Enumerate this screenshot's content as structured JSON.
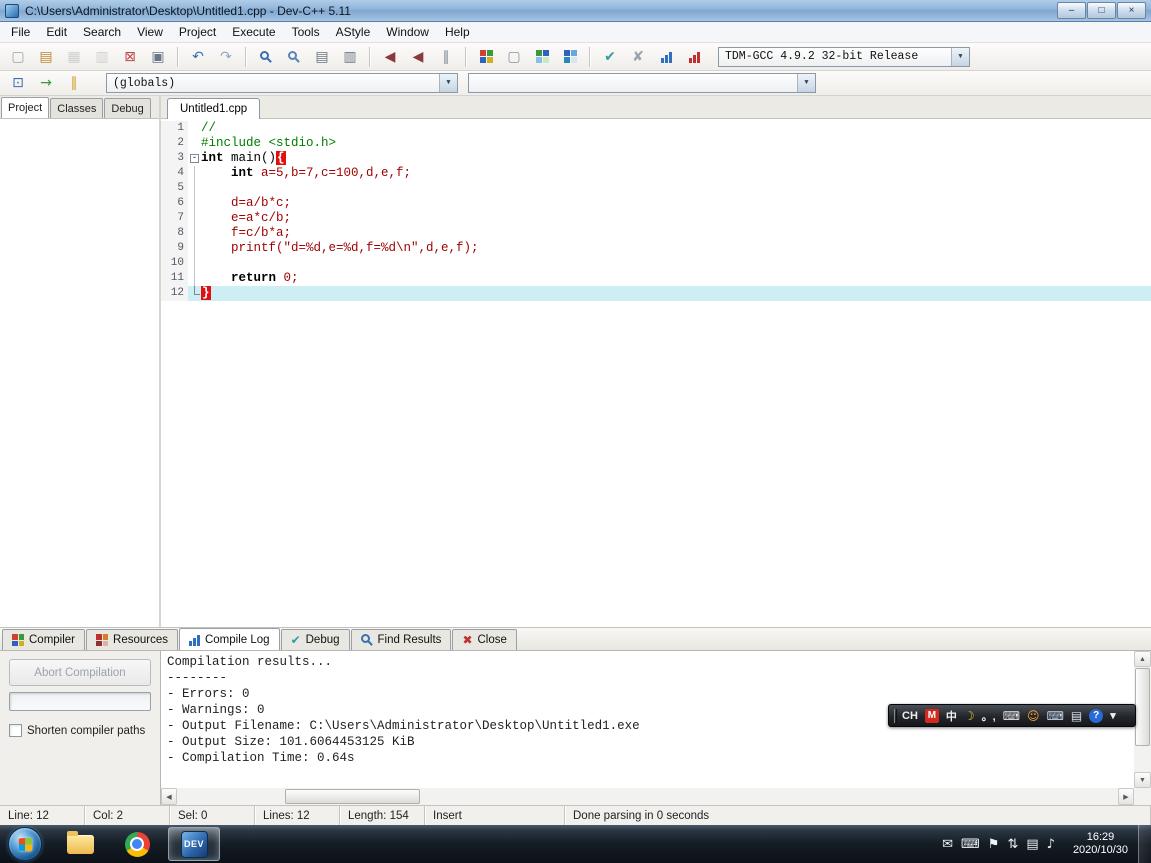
{
  "window": {
    "title": "C:\\Users\\Administrator\\Desktop\\Untitled1.cpp - Dev-C++ 5.11",
    "minimize_glyph": "–",
    "maximize_glyph": "□",
    "close_glyph": "×"
  },
  "ui": {
    "dropdown_arrow": "▼",
    "scroll_up": "▲",
    "scroll_down": "▼",
    "scroll_left": "◀",
    "scroll_right": "▶"
  },
  "colors": {
    "preprocessor_green": "#007d00",
    "code_red": "#9e0000",
    "brace_highlight": "#e01010",
    "current_line": "#cdeef2",
    "accent_blue": "#2f6fbf"
  },
  "menu": [
    "File",
    "Edit",
    "Search",
    "View",
    "Project",
    "Execute",
    "Tools",
    "AStyle",
    "Window",
    "Help"
  ],
  "toolbar1": {
    "compiler_dropdown": "TDM-GCC 4.9.2 32-bit Release",
    "groups": [
      [
        {
          "name": "new-file",
          "kind": "glyph",
          "glyph": "▢",
          "color": "#9aa3ad"
        },
        {
          "name": "open-file",
          "kind": "glyph",
          "glyph": "▤",
          "color": "#c08a30"
        },
        {
          "name": "save",
          "kind": "glyph",
          "glyph": "▦",
          "color": "#8a93a0",
          "disabled": true
        },
        {
          "name": "save-all",
          "kind": "glyph",
          "glyph": "▥",
          "color": "#8a93a0",
          "disabled": true
        },
        {
          "name": "close-file",
          "kind": "glyph",
          "glyph": "⊠",
          "color": "#c04848"
        },
        {
          "name": "print",
          "kind": "glyph",
          "glyph": "▣",
          "color": "#6a7687"
        }
      ],
      [
        {
          "name": "undo",
          "kind": "glyph",
          "glyph": "↶",
          "color": "#3d6eb4"
        },
        {
          "name": "redo",
          "kind": "glyph",
          "glyph": "↷",
          "color": "#93a7c0"
        }
      ],
      [
        {
          "name": "find",
          "kind": "mag",
          "color": "#3d6eb4"
        },
        {
          "name": "replace",
          "kind": "mag",
          "color": "#5a82b8"
        },
        {
          "name": "find-next",
          "kind": "glyph",
          "glyph": "▤",
          "color": "#6a7687"
        },
        {
          "name": "goto-line",
          "kind": "glyph",
          "glyph": "▥",
          "color": "#6a7687"
        }
      ],
      [
        {
          "name": "back",
          "kind": "glyph",
          "glyph": "◀",
          "color": "#8a3a3a"
        },
        {
          "name": "forward",
          "kind": "glyph",
          "glyph": "◀",
          "color": "#8a3a3a"
        },
        {
          "name": "pause",
          "kind": "glyph",
          "glyph": "∥",
          "color": "#7a8694"
        }
      ],
      [
        {
          "name": "compile",
          "kind": "grid4",
          "colors": [
            "#d04030",
            "#3a9a3a",
            "#3060c0",
            "#d0b020"
          ]
        },
        {
          "name": "run",
          "kind": "glyph",
          "glyph": "▢",
          "color": "#8a93a0"
        },
        {
          "name": "compile-run",
          "kind": "grid4",
          "colors": [
            "#3a9a3a",
            "#3060c0",
            "#8ac0e8",
            "#c8e8c8"
          ]
        },
        {
          "name": "rebuild-all",
          "kind": "grid4",
          "colors": [
            "#3060c0",
            "#68a8e0",
            "#2888b8",
            "#d8e4f0"
          ]
        }
      ],
      [
        {
          "name": "syntax-check",
          "kind": "glyph",
          "glyph": "✔",
          "color": "#2f9e9e"
        },
        {
          "name": "clean",
          "kind": "glyph",
          "glyph": "✘",
          "color": "#9aa3ad"
        },
        {
          "name": "profile-analysis",
          "kind": "bars",
          "color": "#2f6fbf"
        },
        {
          "name": "delete-profiling",
          "kind": "bars",
          "color": "#c03030"
        }
      ]
    ]
  },
  "toolbar2": {
    "globals_dropdown": "(globals)",
    "members_dropdown": "",
    "buttons": [
      {
        "name": "open-project",
        "kind": "glyph",
        "glyph": "⊡",
        "color": "#3d6eb4"
      },
      {
        "name": "add-to-project",
        "kind": "glyph",
        "glyph": "→",
        "color": "#3a9a3a"
      },
      {
        "name": "pause-execution",
        "kind": "glyph",
        "glyph": "∥",
        "color": "#d0a020"
      }
    ]
  },
  "left_panel": {
    "tabs": [
      {
        "label": "Project",
        "active": true
      },
      {
        "label": "Classes"
      },
      {
        "label": "Debug"
      }
    ]
  },
  "editor": {
    "tab": "Untitled1.cpp",
    "current_line": 12,
    "lines": [
      {
        "n": 1,
        "segs": [
          {
            "t": "//",
            "c": "green"
          }
        ]
      },
      {
        "n": 2,
        "segs": [
          {
            "t": "#include <stdio.h>",
            "c": "green"
          }
        ]
      },
      {
        "n": 3,
        "fold": "start",
        "segs": [
          {
            "t": "int",
            "c": "kw"
          },
          {
            "t": " main()",
            "c": "plain"
          },
          {
            "t": "{",
            "c": "brace"
          }
        ]
      },
      {
        "n": 4,
        "fold": "mid",
        "segs": [
          {
            "t": "    ",
            "c": "plain"
          },
          {
            "t": "int",
            "c": "kw"
          },
          {
            "t": " a=5,b=7,c=100,d,e,f;",
            "c": "red"
          }
        ]
      },
      {
        "n": 5,
        "fold": "mid",
        "segs": []
      },
      {
        "n": 6,
        "fold": "mid",
        "segs": [
          {
            "t": "    ",
            "c": "plain"
          },
          {
            "t": "d=a/b*c;",
            "c": "red"
          }
        ]
      },
      {
        "n": 7,
        "fold": "mid",
        "segs": [
          {
            "t": "    ",
            "c": "plain"
          },
          {
            "t": "e=a*c/b;",
            "c": "red"
          }
        ]
      },
      {
        "n": 8,
        "fold": "mid",
        "segs": [
          {
            "t": "    ",
            "c": "plain"
          },
          {
            "t": "f=c/b*a;",
            "c": "red"
          }
        ]
      },
      {
        "n": 9,
        "fold": "mid",
        "segs": [
          {
            "t": "    ",
            "c": "plain"
          },
          {
            "t": "printf(\"d=%d,e=%d,f=%d\\n\",d,e,f);",
            "c": "red"
          }
        ]
      },
      {
        "n": 10,
        "fold": "mid",
        "segs": []
      },
      {
        "n": 11,
        "fold": "mid",
        "segs": [
          {
            "t": "    ",
            "c": "plain"
          },
          {
            "t": "return",
            "c": "kw"
          },
          {
            "t": " ",
            "c": "plain"
          },
          {
            "t": "0;",
            "c": "red"
          }
        ]
      },
      {
        "n": 12,
        "fold": "end",
        "segs": [
          {
            "t": "}",
            "c": "brace"
          }
        ]
      }
    ]
  },
  "bottom_tabs": [
    {
      "label": "Compiler",
      "icon": {
        "name": "compiler-tab",
        "kind": "grid4",
        "colors": [
          "#d04030",
          "#3a9a3a",
          "#3060c0",
          "#d0b020"
        ]
      }
    },
    {
      "label": "Resources",
      "icon": {
        "name": "resources-tab",
        "kind": "grid4",
        "colors": [
          "#c03030",
          "#d08030",
          "#903030",
          "#e0b0a0"
        ]
      }
    },
    {
      "label": "Compile Log",
      "active": true,
      "icon": {
        "name": "compile-log-tab",
        "kind": "bars",
        "color": "#2f6fbf"
      }
    },
    {
      "label": "Debug",
      "icon": {
        "name": "debug-tab",
        "kind": "glyph",
        "glyph": "✔",
        "color": "#2f9e9e"
      }
    },
    {
      "label": "Find Results",
      "icon": {
        "name": "find-results-tab",
        "kind": "mag",
        "color": "#3d6eb4"
      }
    },
    {
      "label": "Close",
      "icon": {
        "name": "close-tab",
        "kind": "glyph",
        "glyph": "✖",
        "color": "#c03030"
      }
    }
  ],
  "compile_panel": {
    "abort_button": "Abort Compilation",
    "shorten_checkbox": "Shorten compiler paths",
    "log": [
      "Compilation results...",
      "--------",
      "- Errors: 0",
      "- Warnings: 0",
      "- Output Filename: C:\\Users\\Administrator\\Desktop\\Untitled1.exe",
      "- Output Size: 101.6064453125 KiB",
      "- Compilation Time: 0.64s"
    ]
  },
  "status_bar": [
    "Line: 12",
    "Col: 2",
    "Sel: 0",
    "Lines: 12",
    "Length: 154",
    "Insert",
    "Done parsing in 0 seconds"
  ],
  "language_bar": {
    "items": [
      {
        "name": "input-language",
        "kind": "text",
        "text": "CH"
      },
      {
        "name": "ime-brand",
        "kind": "badge",
        "text": "M",
        "bg": "#d42a1e"
      },
      {
        "name": "chinese-mode",
        "kind": "text",
        "text": "中"
      },
      {
        "name": "full-half-moon",
        "kind": "glyph",
        "glyph": "☽",
        "color": "#f4c430"
      },
      {
        "name": "punctuation",
        "kind": "text",
        "text": "。,"
      },
      {
        "name": "soft-keyboard",
        "kind": "glyph",
        "glyph": "⌨",
        "color": "#e8e8e8"
      },
      {
        "name": "emoticon",
        "kind": "glyph",
        "glyph": "☺",
        "color": "#f4a430"
      },
      {
        "name": "keyboard-layout",
        "kind": "glyph",
        "glyph": "⌨",
        "color": "#c8d8e8"
      },
      {
        "name": "word-pad",
        "kind": "glyph",
        "glyph": "▤",
        "color": "#d8e4f0"
      },
      {
        "name": "help",
        "kind": "badge",
        "text": "?",
        "bg": "#2a6ad4",
        "round": true
      },
      {
        "name": "options-arrow",
        "kind": "text",
        "text": "▾"
      }
    ]
  },
  "taskbar": {
    "clock_time": "16:29",
    "clock_date": "2020/10/30",
    "apps": [
      {
        "name": "explorer",
        "kind": "folder"
      },
      {
        "name": "chrome",
        "kind": "chrome"
      },
      {
        "name": "devcpp",
        "kind": "dev",
        "label": "DEV",
        "active": true
      }
    ],
    "tray": [
      {
        "name": "mail",
        "glyph": "✉"
      },
      {
        "name": "input-method",
        "glyph": "⌨"
      },
      {
        "name": "flag",
        "glyph": "⚑"
      },
      {
        "name": "network",
        "glyph": "⇅"
      },
      {
        "name": "display",
        "glyph": "▤"
      },
      {
        "name": "volume",
        "glyph": "♪"
      }
    ]
  }
}
